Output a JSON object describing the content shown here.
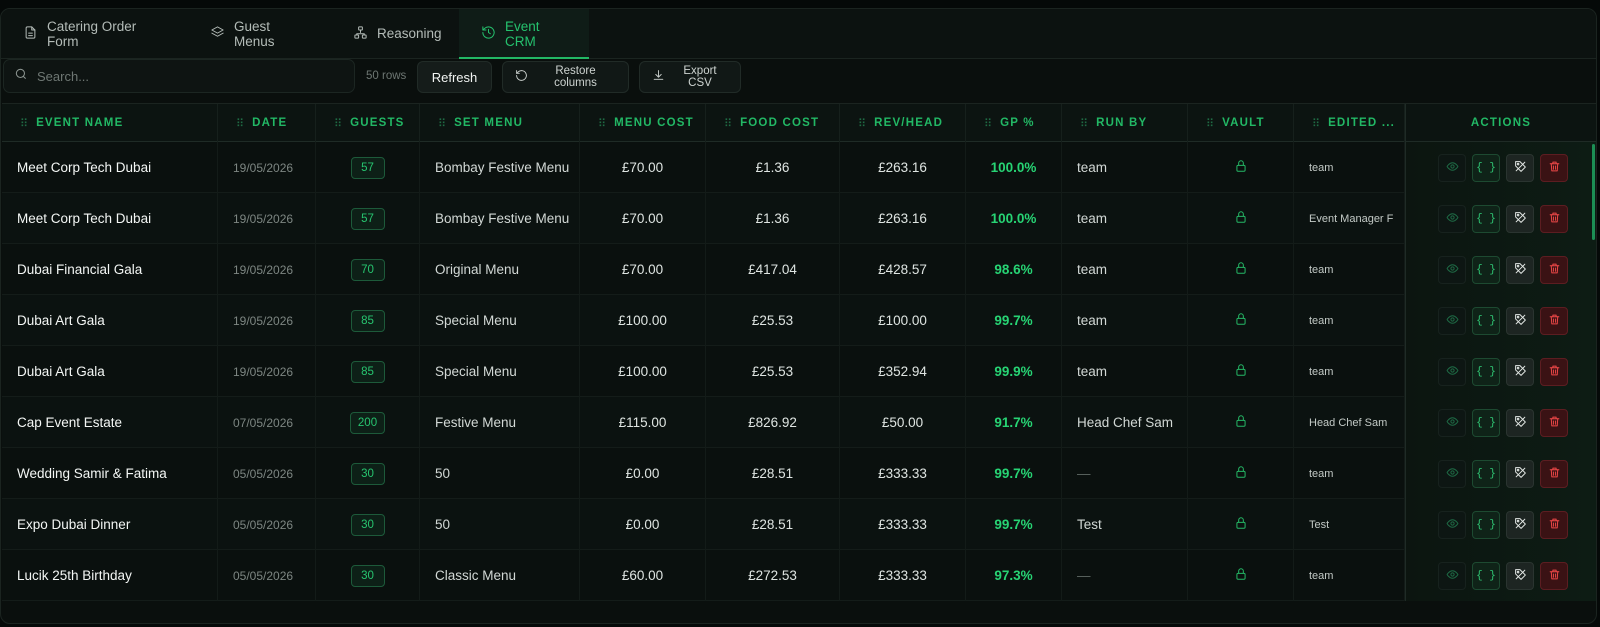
{
  "tabs": [
    {
      "label": "Catering Order Form",
      "icon": "document-icon"
    },
    {
      "label": "Guest Menus",
      "icon": "layers-icon"
    },
    {
      "label": "Reasoning",
      "icon": "network-icon"
    },
    {
      "label": "Event CRM",
      "icon": "history-icon",
      "active": true
    }
  ],
  "toolbar": {
    "search_placeholder": "Search...",
    "rows_count": "50 rows",
    "refresh_label": "Refresh",
    "restore_label": "Restore columns",
    "export_label": "Export CSV"
  },
  "columns": [
    "EVENT NAME",
    "DATE",
    "GUESTS",
    "SET MENU",
    "MENU COST",
    "FOOD COST",
    "REV/HEAD",
    "GP %",
    "RUN BY",
    "VAULT",
    "EDITED ...",
    "ACTIONS"
  ],
  "rows": [
    {
      "event_name": "Meet Corp Tech Dubai",
      "date": "19/05/2026",
      "guests": "57",
      "set_menu": "Bombay Festive Menu",
      "menu_cost": "£70.00",
      "food_cost": "£1.36",
      "rev_head": "£263.16",
      "gp": "100.0%",
      "run_by": "team",
      "edited": "team"
    },
    {
      "event_name": "Meet Corp Tech Dubai",
      "date": "19/05/2026",
      "guests": "57",
      "set_menu": "Bombay Festive Menu",
      "menu_cost": "£70.00",
      "food_cost": "£1.36",
      "rev_head": "£263.16",
      "gp": "100.0%",
      "run_by": "team",
      "edited": "Event Manager F"
    },
    {
      "event_name": "Dubai Financial Gala",
      "date": "19/05/2026",
      "guests": "70",
      "set_menu": "Original Menu",
      "menu_cost": "£70.00",
      "food_cost": "£417.04",
      "rev_head": "£428.57",
      "gp": "98.6%",
      "run_by": "team",
      "edited": "team"
    },
    {
      "event_name": "Dubai Art Gala",
      "date": "19/05/2026",
      "guests": "85",
      "set_menu": "Special Menu",
      "menu_cost": "£100.00",
      "food_cost": "£25.53",
      "rev_head": "£100.00",
      "gp": "99.7%",
      "run_by": "team",
      "edited": "team"
    },
    {
      "event_name": "Dubai Art Gala",
      "date": "19/05/2026",
      "guests": "85",
      "set_menu": "Special Menu",
      "menu_cost": "£100.00",
      "food_cost": "£25.53",
      "rev_head": "£352.94",
      "gp": "99.9%",
      "run_by": "team",
      "edited": "team"
    },
    {
      "event_name": "Cap Event Estate",
      "date": "07/05/2026",
      "guests": "200",
      "set_menu": "Festive Menu",
      "menu_cost": "£115.00",
      "food_cost": "£826.92",
      "rev_head": "£50.00",
      "gp": "91.7%",
      "run_by": "Head Chef Sam",
      "edited": "Head Chef Sam"
    },
    {
      "event_name": "Wedding Samir & Fatima",
      "date": "05/05/2026",
      "guests": "30",
      "set_menu": "50",
      "menu_cost": "£0.00",
      "food_cost": "£28.51",
      "rev_head": "£333.33",
      "gp": "99.7%",
      "run_by": "—",
      "edited": "team"
    },
    {
      "event_name": "Expo Dubai Dinner",
      "date": "05/05/2026",
      "guests": "30",
      "set_menu": "50",
      "menu_cost": "£0.00",
      "food_cost": "£28.51",
      "rev_head": "£333.33",
      "gp": "99.7%",
      "run_by": "Test",
      "edited": "Test"
    },
    {
      "event_name": "Lucik 25th Birthday",
      "date": "05/05/2026",
      "guests": "30",
      "set_menu": "Classic Menu",
      "menu_cost": "£60.00",
      "food_cost": "£272.53",
      "rev_head": "£333.33",
      "gp": "97.3%",
      "run_by": "—",
      "edited": "team"
    }
  ],
  "json_button_label": "{ }",
  "colors": {
    "accent": "#22b865",
    "gp": "#27d474",
    "danger": "#f04848",
    "background": "#0a0f0d"
  }
}
